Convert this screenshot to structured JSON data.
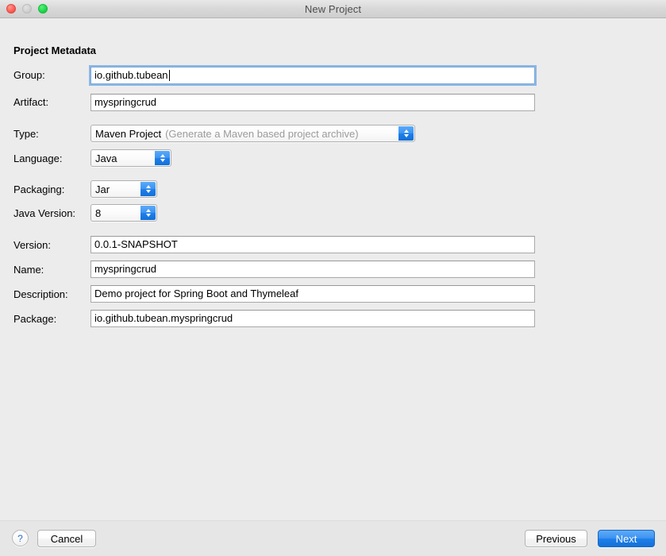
{
  "window": {
    "title": "New Project",
    "traffic_lights": [
      {
        "name": "close",
        "color": "#ff5f57"
      },
      {
        "name": "minimize",
        "color": "#d2d2d2"
      },
      {
        "name": "zoom",
        "color": "#1ed94b"
      }
    ]
  },
  "form": {
    "section_title": "Project Metadata",
    "fields": {
      "group": {
        "label": "Group:",
        "value": "io.github.tubean",
        "value_head": "io.github.",
        "value_misspelled": "tubean",
        "focused": true
      },
      "artifact": {
        "label": "Artifact:",
        "value": "myspringcrud"
      },
      "type": {
        "label": "Type:",
        "value": "Maven Project",
        "hint": "(Generate a Maven based project archive)"
      },
      "language": {
        "label": "Language:",
        "value": "Java"
      },
      "packaging": {
        "label": "Packaging:",
        "value": "Jar"
      },
      "java_version": {
        "label": "Java Version:",
        "value": "8"
      },
      "version": {
        "label": "Version:",
        "value": "0.0.1-SNAPSHOT"
      },
      "name": {
        "label": "Name:",
        "value": "myspringcrud"
      },
      "description": {
        "label": "Description:",
        "value": "Demo project for Spring Boot and Thymeleaf"
      },
      "package": {
        "label": "Package:",
        "value": "io.github.tubean.myspringcrud"
      }
    }
  },
  "footer": {
    "help_label": "?",
    "cancel_label": "Cancel",
    "previous_label": "Previous",
    "next_label": "Next",
    "accent_color": "#1f80ea"
  }
}
